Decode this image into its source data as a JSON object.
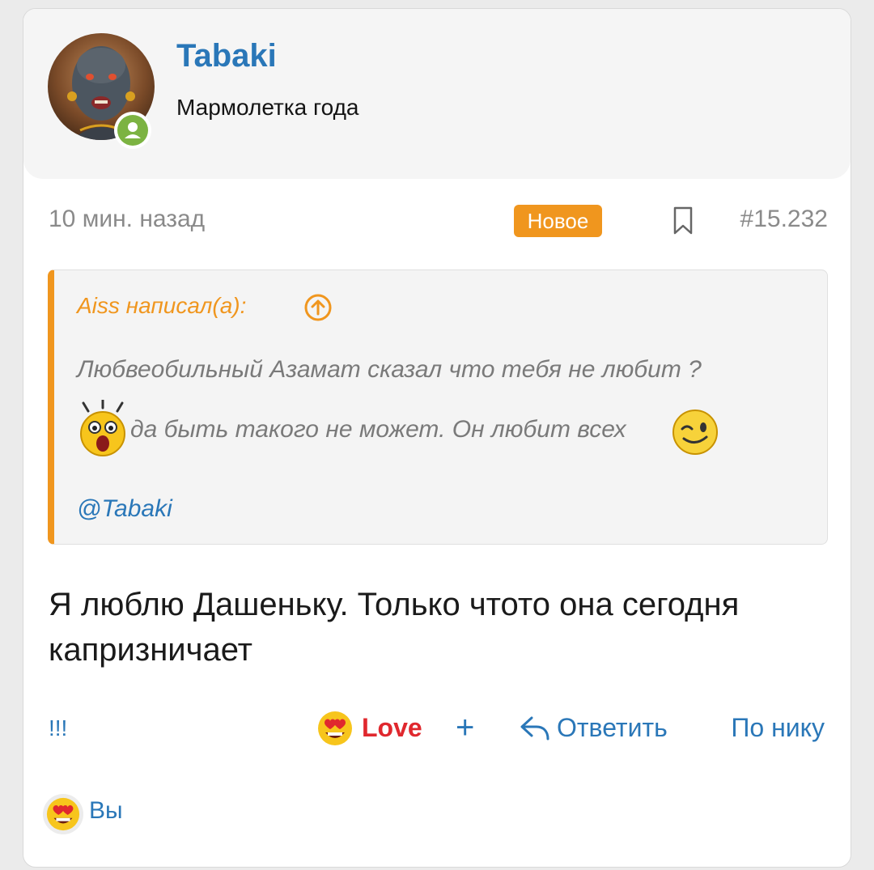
{
  "post": {
    "author": {
      "name": "Tabaki",
      "title": "Мармолетка года",
      "avatar_icon": "user-avatar",
      "status_icon": "online-user-icon",
      "status_color": "#7cb342"
    },
    "time": "10 мин. назад",
    "badge": "Новое",
    "bookmark_icon": "bookmark-icon",
    "number": "#15.232",
    "quote": {
      "author_label": "Aiss написал(а):",
      "goto_icon": "arrow-up-circle-icon",
      "line1": "Любвеобильный Азамат сказал что тебя не любит ?",
      "emoji_before": "shocked-smiley-icon",
      "line2": "да быть такого не может. Он любит всех",
      "emoji_after": "wink-smiley-icon",
      "mention": "@Tabaki"
    },
    "message": "Я люблю Дашеньку. Только чтото она сегодня капризничает",
    "actions": {
      "report": "!!!",
      "reaction_label": "Love",
      "reaction_icon": "heart-eyes-icon",
      "add_reaction": "+",
      "reply_icon": "reply-icon",
      "reply": "Ответить",
      "by_nick": "По нику"
    },
    "reactions_summary": {
      "icon": "heart-eyes-icon",
      "users": "Вы"
    }
  },
  "colors": {
    "accent_blue": "#2a77b8",
    "accent_orange": "#f0961e",
    "love_red": "#e0282e",
    "background": "#ebebeb"
  }
}
